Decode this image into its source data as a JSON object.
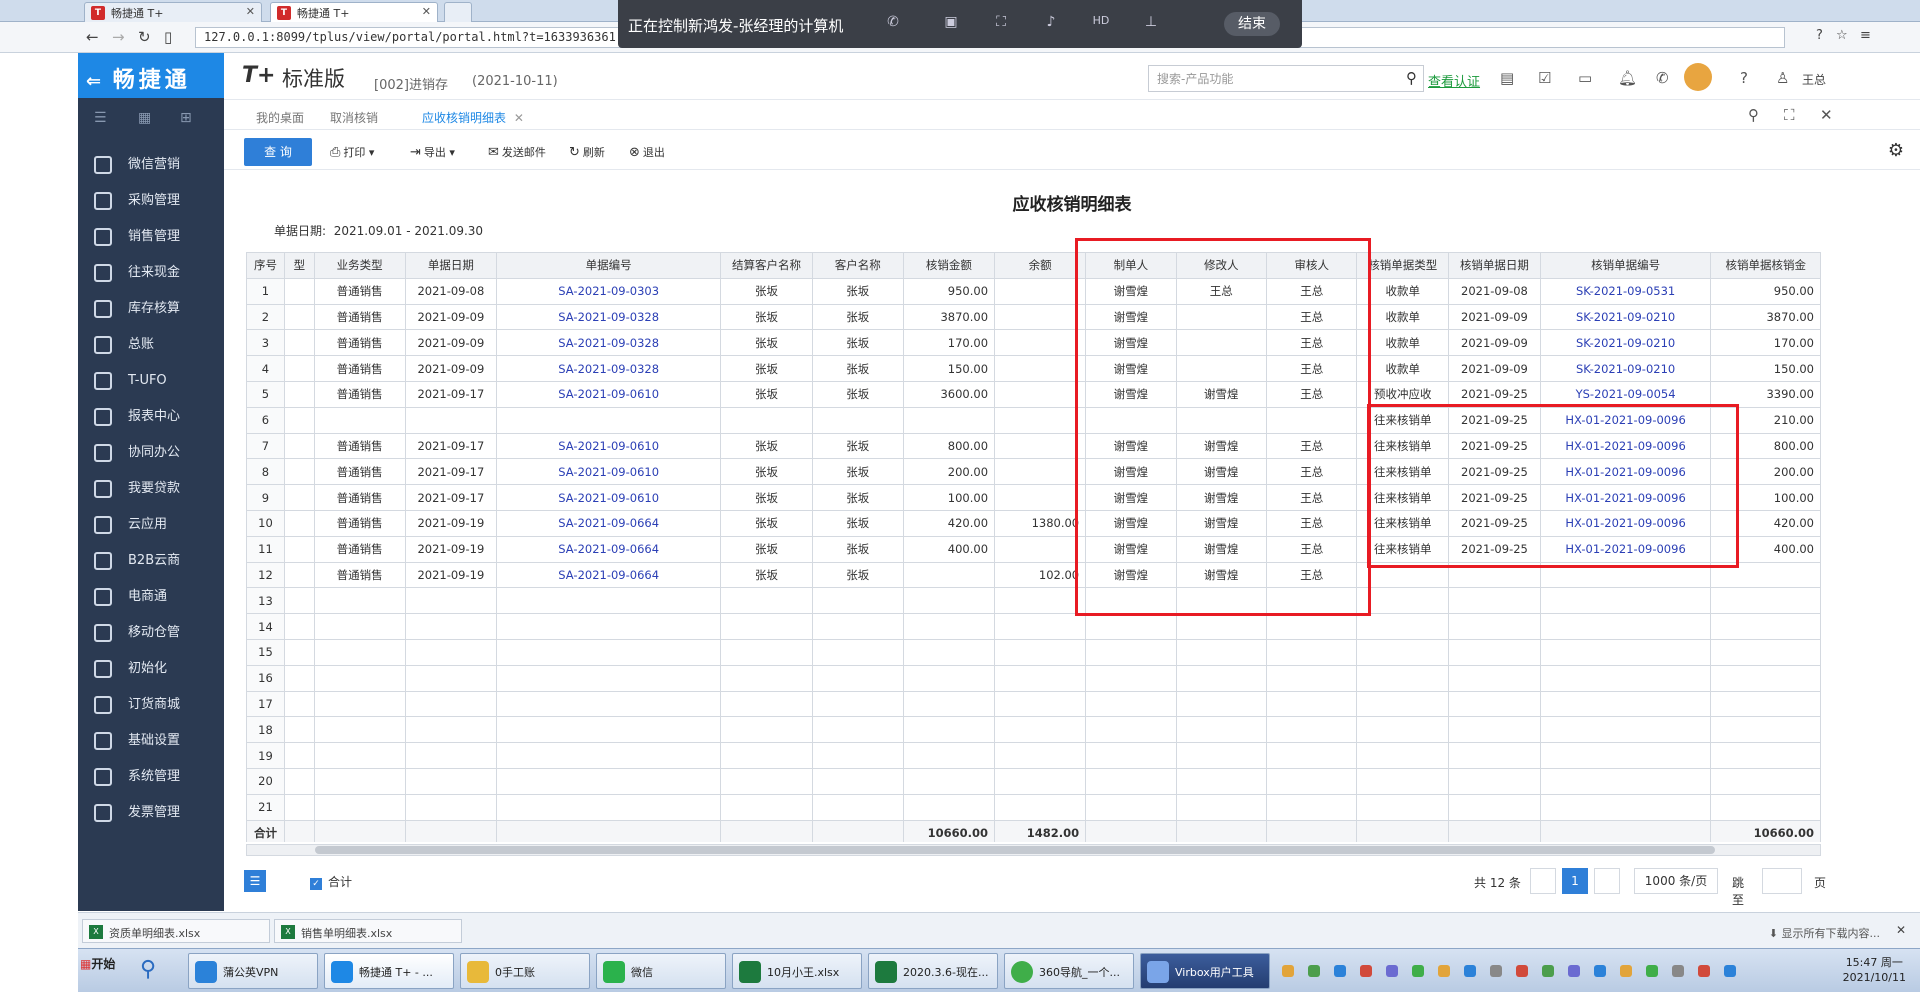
{
  "browser": {
    "tabs": [
      {
        "label": "畅捷通 T+"
      },
      {
        "label": "畅捷通 T+"
      }
    ],
    "url": "127.0.0.1:8099/tplus/view/portal/portal.html?t=1633936361",
    "remote_banner": "正在控制新鸿发-张经理的计算机",
    "remote_end": "结束"
  },
  "sidebar": {
    "logo": "畅捷通",
    "items": [
      {
        "label": "微信营销"
      },
      {
        "label": "采购管理"
      },
      {
        "label": "销售管理"
      },
      {
        "label": "往来现金"
      },
      {
        "label": "库存核算"
      },
      {
        "label": "总账"
      },
      {
        "label": "T-UFO"
      },
      {
        "label": "报表中心"
      },
      {
        "label": "协同办公"
      },
      {
        "label": "我要贷款"
      },
      {
        "label": "云应用"
      },
      {
        "label": "B2B云商"
      },
      {
        "label": "电商通"
      },
      {
        "label": "移动仓管"
      },
      {
        "label": "初始化"
      },
      {
        "label": "订货商城"
      },
      {
        "label": "基础设置"
      },
      {
        "label": "系统管理"
      },
      {
        "label": "发票管理"
      }
    ]
  },
  "header": {
    "product_mark": "T+",
    "product_name": "标准版",
    "account": "[002]进销存",
    "account_date": "(2021-10-11)",
    "search_placeholder": "搜索-产品功能",
    "certify": "查看认证",
    "user": "王总"
  },
  "page_tabs": [
    {
      "label": "我的桌面"
    },
    {
      "label": "取消核销"
    },
    {
      "label": "应收核销明细表"
    }
  ],
  "toolbar": {
    "query": "查 询",
    "print": "打印",
    "export": "导出",
    "email": "发送邮件",
    "refresh": "刷新",
    "exit": "退出"
  },
  "report": {
    "title": "应收核销明细表",
    "date_label": "单据日期:",
    "date_range": "2021.09.01 - 2021.09.30",
    "columns": [
      "序号",
      "型",
      "业务类型",
      "单据日期",
      "单据编号",
      "结算客户名称",
      "客户名称",
      "核销金额",
      "余额",
      "制单人",
      "修改人",
      "审核人",
      "核销单据类型",
      "核销单据日期",
      "核销单据编号",
      "核销单据核销金"
    ],
    "rows": [
      [
        "1",
        "",
        "普通销售",
        "2021-09-08",
        "SA-2021-09-0303",
        "张坂",
        "张坂",
        "950.00",
        "",
        "谢雪煌",
        "王总",
        "王总",
        "收款单",
        "2021-09-08",
        "SK-2021-09-0531",
        "950.00"
      ],
      [
        "2",
        "",
        "普通销售",
        "2021-09-09",
        "SA-2021-09-0328",
        "张坂",
        "张坂",
        "3870.00",
        "",
        "谢雪煌",
        "",
        "王总",
        "收款单",
        "2021-09-09",
        "SK-2021-09-0210",
        "3870.00"
      ],
      [
        "3",
        "",
        "普通销售",
        "2021-09-09",
        "SA-2021-09-0328",
        "张坂",
        "张坂",
        "170.00",
        "",
        "谢雪煌",
        "",
        "王总",
        "收款单",
        "2021-09-09",
        "SK-2021-09-0210",
        "170.00"
      ],
      [
        "4",
        "",
        "普通销售",
        "2021-09-09",
        "SA-2021-09-0328",
        "张坂",
        "张坂",
        "150.00",
        "",
        "谢雪煌",
        "",
        "王总",
        "收款单",
        "2021-09-09",
        "SK-2021-09-0210",
        "150.00"
      ],
      [
        "5",
        "",
        "普通销售",
        "2021-09-17",
        "SA-2021-09-0610",
        "张坂",
        "张坂",
        "3600.00",
        "",
        "谢雪煌",
        "谢雪煌",
        "王总",
        "预收冲应收",
        "2021-09-25",
        "YS-2021-09-0054",
        "3390.00"
      ],
      [
        "6",
        "",
        "",
        "",
        "",
        "",
        "",
        "",
        "",
        "",
        "",
        "",
        "往来核销单",
        "2021-09-25",
        "HX-01-2021-09-0096",
        "210.00"
      ],
      [
        "7",
        "",
        "普通销售",
        "2021-09-17",
        "SA-2021-09-0610",
        "张坂",
        "张坂",
        "800.00",
        "",
        "谢雪煌",
        "谢雪煌",
        "王总",
        "往来核销单",
        "2021-09-25",
        "HX-01-2021-09-0096",
        "800.00"
      ],
      [
        "8",
        "",
        "普通销售",
        "2021-09-17",
        "SA-2021-09-0610",
        "张坂",
        "张坂",
        "200.00",
        "",
        "谢雪煌",
        "谢雪煌",
        "王总",
        "往来核销单",
        "2021-09-25",
        "HX-01-2021-09-0096",
        "200.00"
      ],
      [
        "9",
        "",
        "普通销售",
        "2021-09-17",
        "SA-2021-09-0610",
        "张坂",
        "张坂",
        "100.00",
        "",
        "谢雪煌",
        "谢雪煌",
        "王总",
        "往来核销单",
        "2021-09-25",
        "HX-01-2021-09-0096",
        "100.00"
      ],
      [
        "10",
        "",
        "普通销售",
        "2021-09-19",
        "SA-2021-09-0664",
        "张坂",
        "张坂",
        "420.00",
        "1380.00",
        "谢雪煌",
        "谢雪煌",
        "王总",
        "往来核销单",
        "2021-09-25",
        "HX-01-2021-09-0096",
        "420.00"
      ],
      [
        "11",
        "",
        "普通销售",
        "2021-09-19",
        "SA-2021-09-0664",
        "张坂",
        "张坂",
        "400.00",
        "",
        "谢雪煌",
        "谢雪煌",
        "王总",
        "往来核销单",
        "2021-09-25",
        "HX-01-2021-09-0096",
        "400.00"
      ],
      [
        "12",
        "",
        "普通销售",
        "2021-09-19",
        "SA-2021-09-0664",
        "张坂",
        "张坂",
        "",
        "102.00",
        "谢雪煌",
        "谢雪煌",
        "王总",
        "",
        "",
        "",
        ""
      ],
      [
        "13",
        "",
        "",
        "",
        "",
        "",
        "",
        "",
        "",
        "",
        "",
        "",
        "",
        "",
        "",
        ""
      ],
      [
        "14",
        "",
        "",
        "",
        "",
        "",
        "",
        "",
        "",
        "",
        "",
        "",
        "",
        "",
        "",
        ""
      ],
      [
        "15",
        "",
        "",
        "",
        "",
        "",
        "",
        "",
        "",
        "",
        "",
        "",
        "",
        "",
        "",
        ""
      ],
      [
        "16",
        "",
        "",
        "",
        "",
        "",
        "",
        "",
        "",
        "",
        "",
        "",
        "",
        "",
        "",
        ""
      ],
      [
        "17",
        "",
        "",
        "",
        "",
        "",
        "",
        "",
        "",
        "",
        "",
        "",
        "",
        "",
        "",
        ""
      ],
      [
        "18",
        "",
        "",
        "",
        "",
        "",
        "",
        "",
        "",
        "",
        "",
        "",
        "",
        "",
        "",
        ""
      ],
      [
        "19",
        "",
        "",
        "",
        "",
        "",
        "",
        "",
        "",
        "",
        "",
        "",
        "",
        "",
        "",
        ""
      ],
      [
        "20",
        "",
        "",
        "",
        "",
        "",
        "",
        "",
        "",
        "",
        "",
        "",
        "",
        "",
        "",
        ""
      ],
      [
        "21",
        "",
        "",
        "",
        "",
        "",
        "",
        "",
        "",
        "",
        "",
        "",
        "",
        "",
        "",
        ""
      ]
    ],
    "total": {
      "label": "合计",
      "amount": "10660.00",
      "balance": "1482.00",
      "writeoff": "10660.00"
    }
  },
  "footer": {
    "show_total": "合计",
    "count": "共 12 条",
    "page": "1",
    "page_size": "1000 条/页",
    "jump": "跳至",
    "page_unit": "页"
  },
  "downloads": {
    "files": [
      {
        "label": "资质单明细表.xlsx"
      },
      {
        "label": "销售单明细表.xlsx"
      }
    ],
    "show_all": "显示所有下载内容..."
  },
  "taskbar": {
    "start": "开始",
    "tasks": [
      {
        "label": "蒲公英VPN"
      },
      {
        "label": "畅捷通 T+ - ..."
      },
      {
        "label": "0手工账"
      },
      {
        "label": "微信"
      },
      {
        "label": "10月小王.xlsx"
      },
      {
        "label": "2020.3.6-现在..."
      },
      {
        "label": "360导航_一个..."
      },
      {
        "label": "Virbox用户工具"
      }
    ],
    "time": "15:47 周一",
    "date": "2021/10/11"
  },
  "colors": {
    "accent": "#1e88e5",
    "sidebar": "#2b3a52",
    "highlight": "#e81b23",
    "link": "#2b3fb5"
  }
}
